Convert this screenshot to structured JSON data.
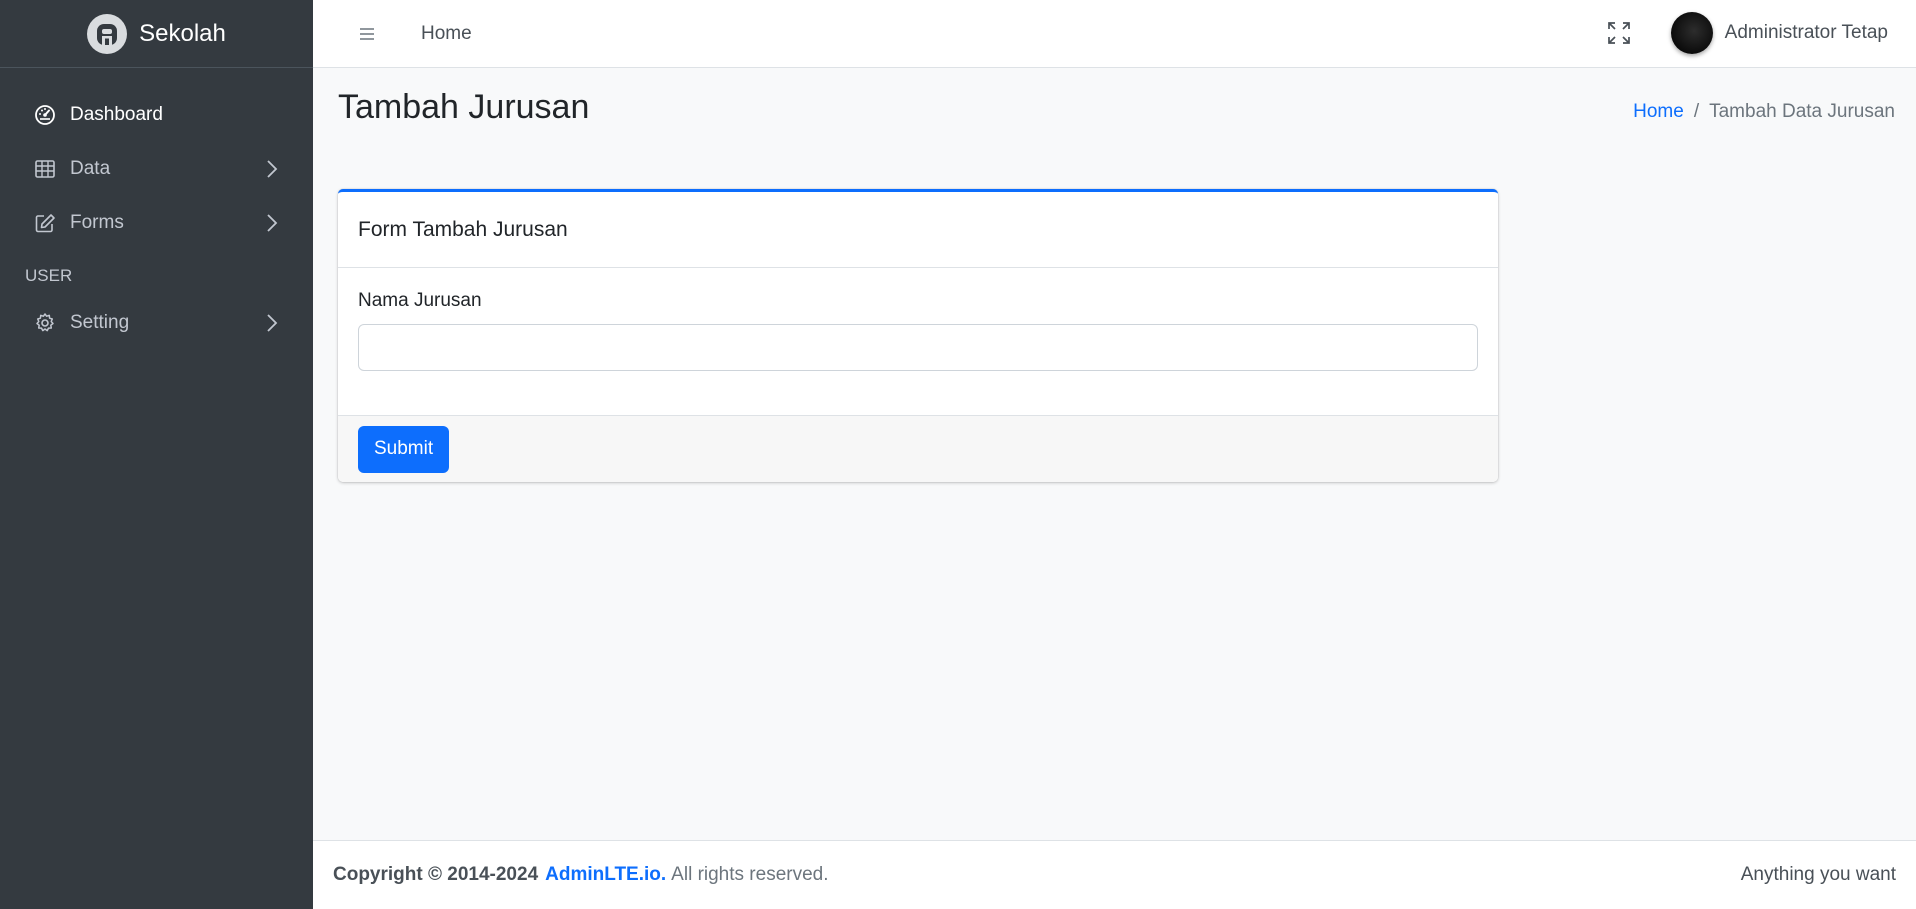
{
  "brand": {
    "name": "Sekolah",
    "logo_icon": "adminlte-logo-icon"
  },
  "sidebar": {
    "items": [
      {
        "label": "Dashboard",
        "icon": "speedometer-icon",
        "active": true
      },
      {
        "label": "Data",
        "icon": "table-icon",
        "has_children": true
      },
      {
        "label": "Forms",
        "icon": "pencil-square-icon",
        "has_children": true
      }
    ],
    "header": "USER",
    "user_items": [
      {
        "label": "Setting",
        "icon": "gear-icon",
        "has_children": true
      }
    ]
  },
  "topbar": {
    "home_link": "Home",
    "user_name": "Administrator Tetap"
  },
  "page": {
    "title": "Tambah Jurusan",
    "breadcrumb": {
      "home": "Home",
      "separator": "/",
      "current": "Tambah Data Jurusan"
    }
  },
  "card": {
    "title": "Form Tambah Jurusan",
    "field_label": "Nama Jurusan",
    "field_value": "",
    "submit_label": "Submit"
  },
  "footer": {
    "copyright": "Copyright © 2014-2024",
    "link": "AdminLTE.io.",
    "rights": "All rights reserved.",
    "right_text": "Anything you want"
  },
  "colors": {
    "sidebar_bg": "#343a40",
    "primary": "#0d6efd",
    "content_bg": "#f8f9fa"
  }
}
